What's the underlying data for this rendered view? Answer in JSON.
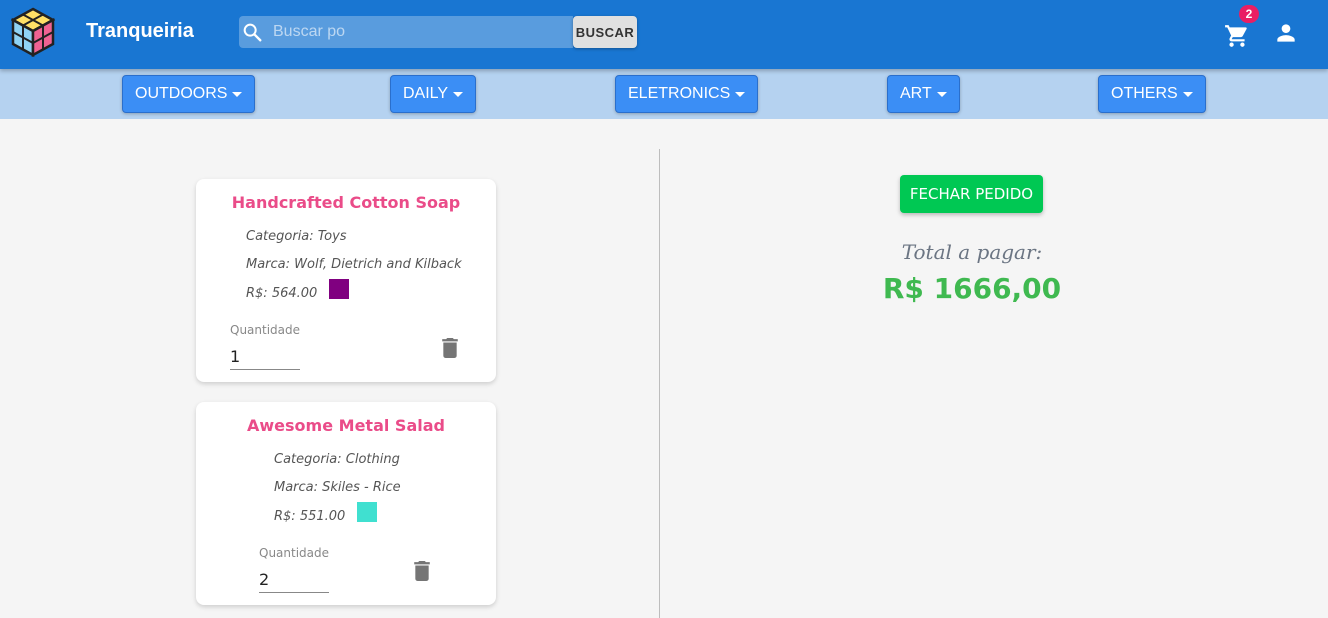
{
  "header": {
    "brand": "Tranqueiria",
    "search": {
      "placeholder": "Buscar po",
      "button": "BUSCAR"
    },
    "cart_count": "2",
    "color": "#1976d2"
  },
  "categories": [
    {
      "label": "OUTDOORS"
    },
    {
      "label": "DAILY"
    },
    {
      "label": "ELETRONICS"
    },
    {
      "label": "ART"
    },
    {
      "label": "OTHERS"
    }
  ],
  "cart_items": [
    {
      "title": "Handcrafted Cotton Soap",
      "category": "Categoria: Toys",
      "brand": "Marca: Wolf, Dietrich and Kilback",
      "price": "R$: 564.00",
      "color": "#800080",
      "qty_label": "Quantidade",
      "qty": "1"
    },
    {
      "title": "Awesome Metal Salad",
      "category": "Categoria: Clothing",
      "brand": "Marca: Skiles - Rice",
      "price": "R$: 551.00",
      "color": "#40e0d0",
      "qty_label": "Quantidade",
      "qty": "2"
    }
  ],
  "summary": {
    "checkout_button": "FECHAR PEDIDO",
    "total_label": "Total a pagar:",
    "total_value": "R$ 1666,00"
  }
}
